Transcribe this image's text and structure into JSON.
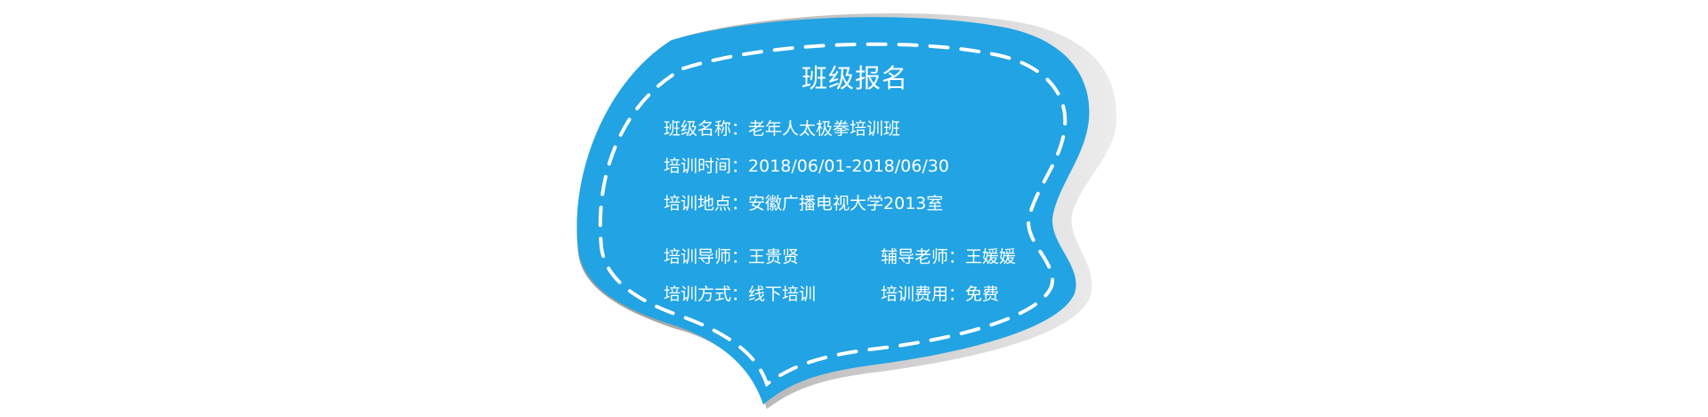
{
  "card": {
    "title": "班级报名",
    "colors": {
      "bubble": "#22a3e3",
      "shadow": "#c8c8c8",
      "dash": "#ffffff",
      "text": "#ffffff"
    },
    "separator": "：",
    "fields": {
      "class_name": {
        "label": "班级名称",
        "value": "老年人太极拳培训班"
      },
      "training_time": {
        "label": "培训时间",
        "value": "2018/06/01-2018/06/30"
      },
      "training_location": {
        "label": "培训地点",
        "value": "安徽广播电视大学2013室"
      },
      "instructor": {
        "label": "培训导师",
        "value": "王贵贤"
      },
      "assistant_teacher": {
        "label": "辅导老师",
        "value": "王媛媛"
      },
      "training_mode": {
        "label": "培训方式",
        "value": "线下培训"
      },
      "training_fee": {
        "label": "培训费用",
        "value": "免费"
      }
    }
  }
}
